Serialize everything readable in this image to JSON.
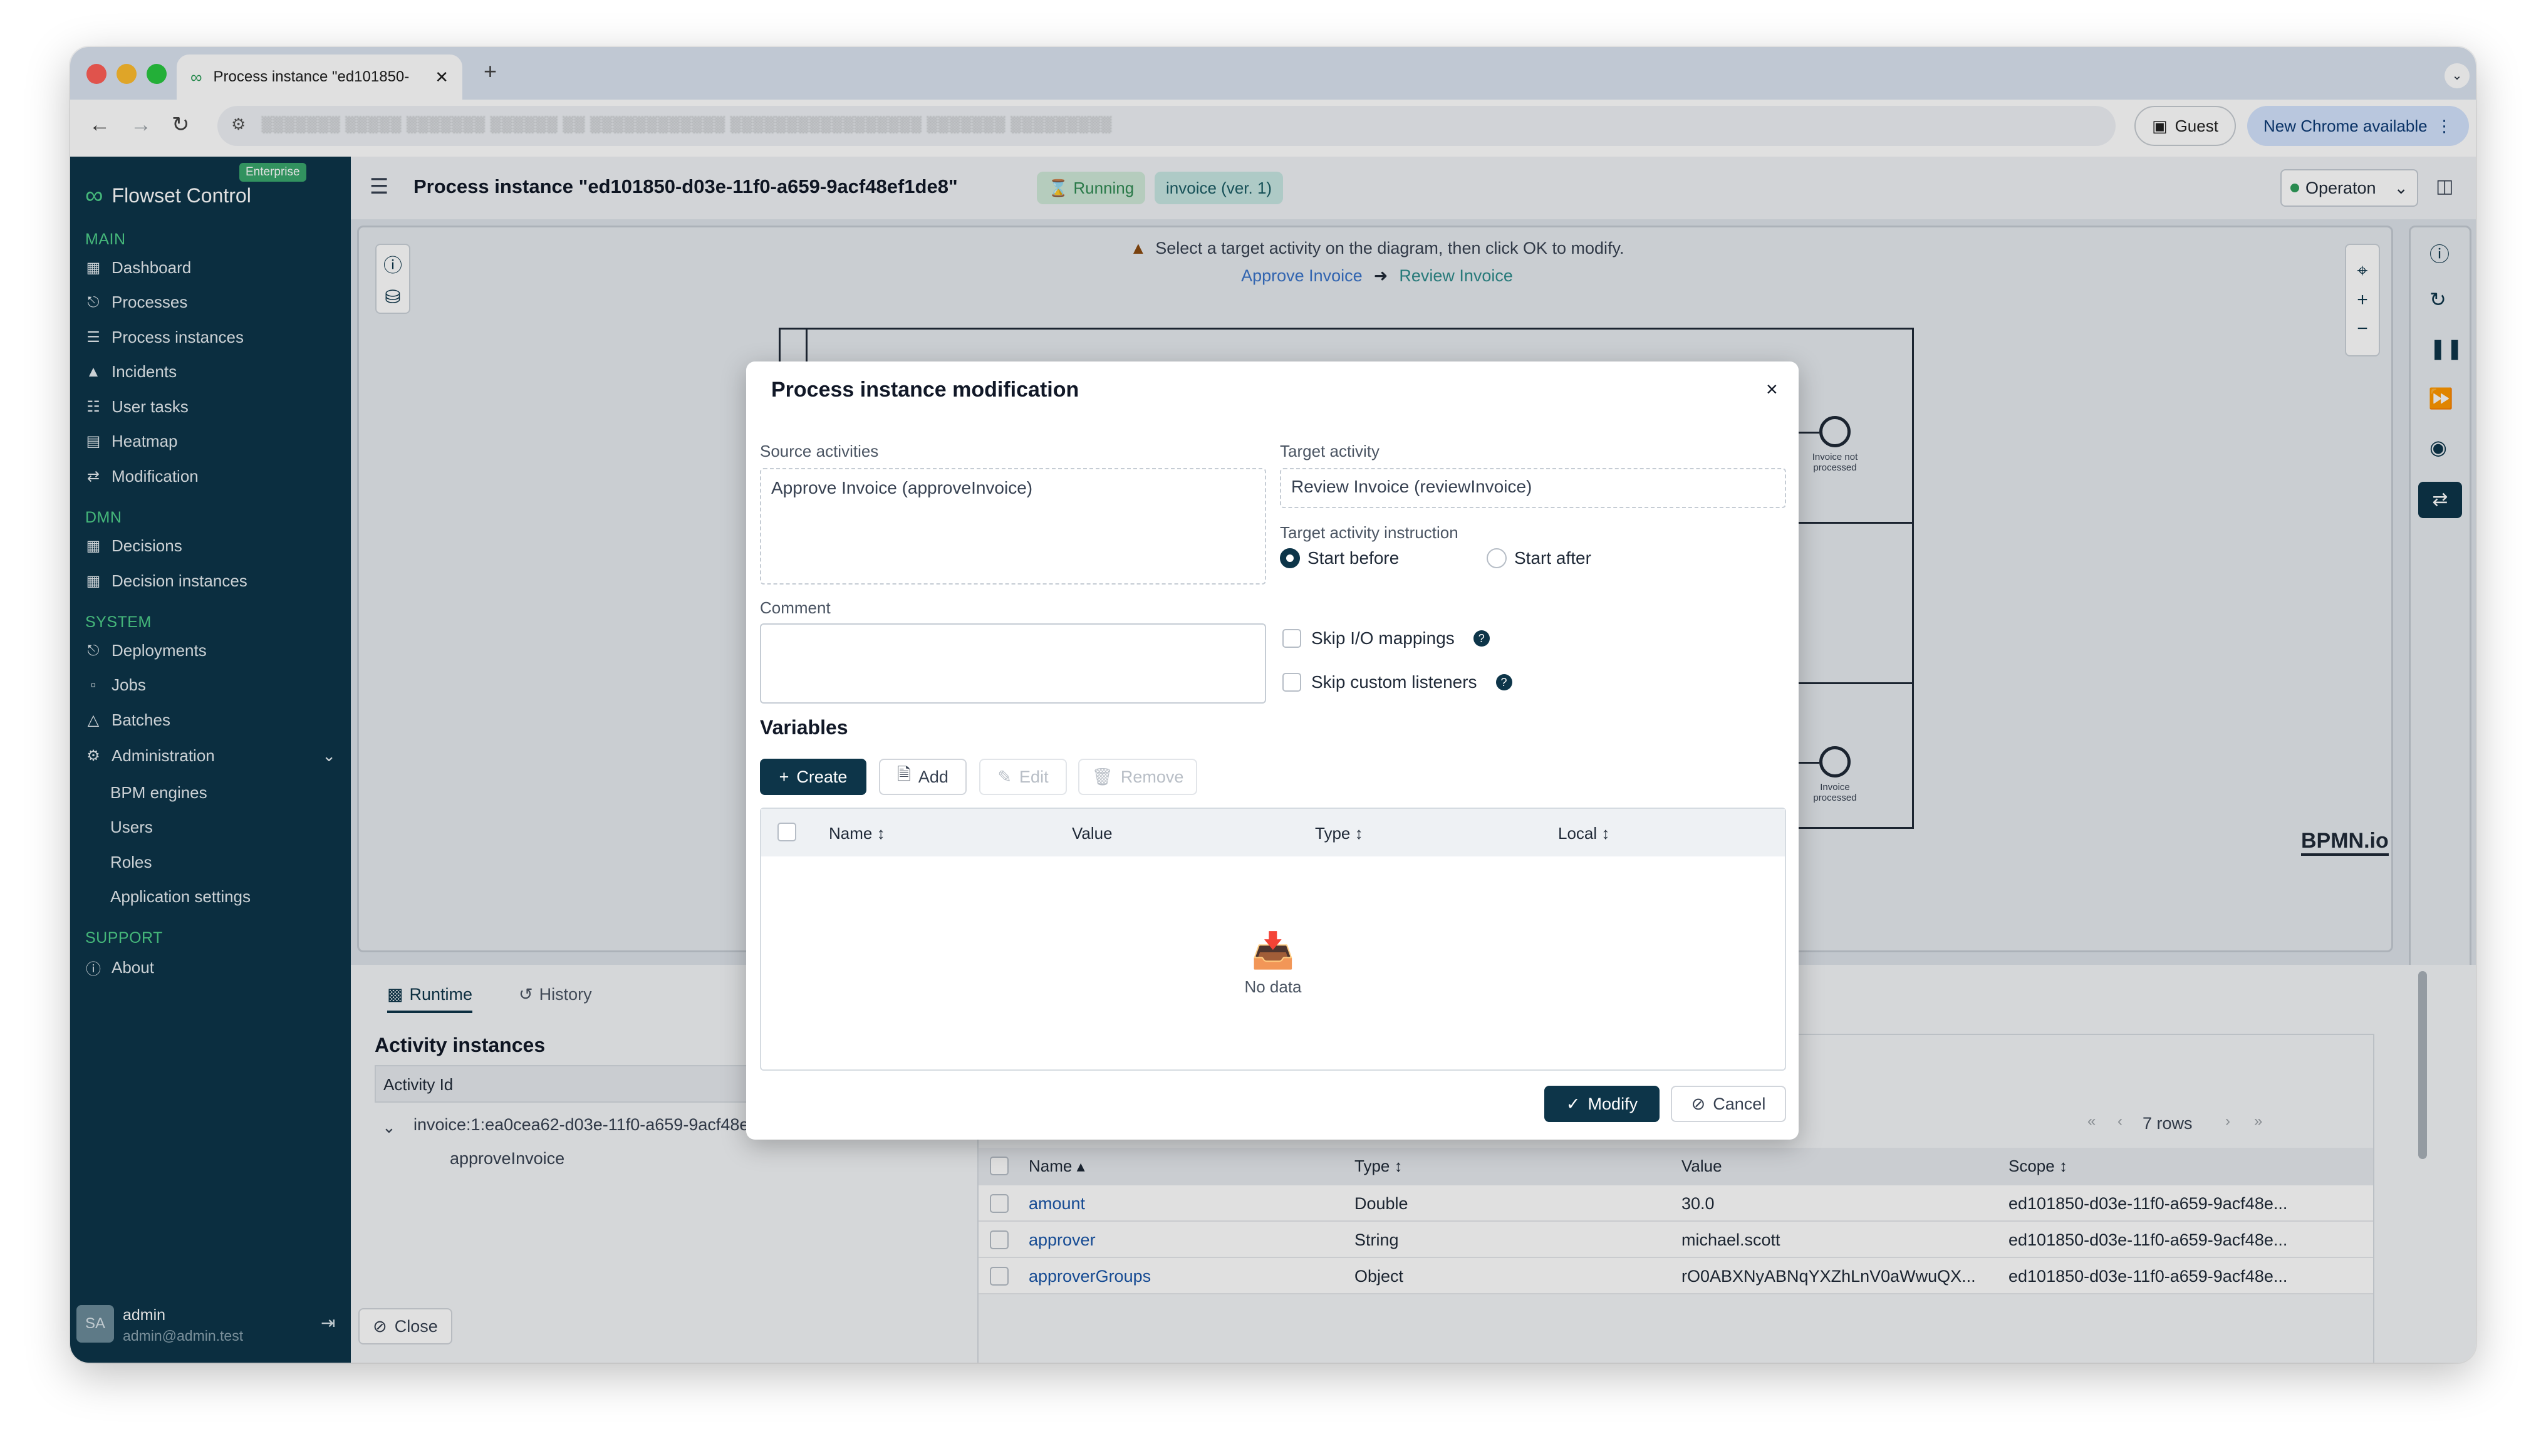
{
  "browser": {
    "tab_title": "Process instance \"ed101850-",
    "url": "░░░░░░░ ░░░░░ ░░░░░░░ ░░░░░░ ░░ ░░░░░░░░░░░░ ░░░░░░░░░░░░░░░░░ ░░░░░░░ ░░░░░░░░░",
    "guest_label": "Guest",
    "update_label": "New Chrome available"
  },
  "sidebar": {
    "brand": "Flowset Control",
    "edition": "Enterprise",
    "sections": {
      "main": "MAIN",
      "dmn": "DMN",
      "system": "SYSTEM",
      "support": "SUPPORT"
    },
    "items": {
      "dashboard": "Dashboard",
      "processes": "Processes",
      "process_instances": "Process instances",
      "incidents": "Incidents",
      "user_tasks": "User tasks",
      "heatmap": "Heatmap",
      "modification": "Modification",
      "decisions": "Decisions",
      "decision_instances": "Decision instances",
      "deployments": "Deployments",
      "jobs": "Jobs",
      "batches": "Batches",
      "administration": "Administration",
      "bpm_engines": "BPM engines",
      "users": "Users",
      "roles": "Roles",
      "application_settings": "Application settings",
      "about": "About"
    },
    "user": {
      "initials": "SA",
      "name": "admin",
      "email": "admin@admin.test"
    }
  },
  "header": {
    "title": "Process instance \"ed101850-d03e-11f0-a659-9acf48ef1de8\"",
    "status": "Running",
    "definition": "invoice (ver. 1)",
    "engine": "Operaton"
  },
  "diagram": {
    "hint": "Select a target activity on the diagram, then click OK to modify.",
    "from": "Approve Invoice",
    "to": "Review Invoice",
    "end_event_1": "Invoice not processed",
    "end_event_2": "Invoice processed",
    "bpmn_logo": "BPMN.io"
  },
  "modal": {
    "title": "Process instance modification",
    "source_label": "Source activities",
    "source_value": "Approve Invoice (approveInvoice)",
    "target_label": "Target activity",
    "target_value": "Review Invoice (reviewInvoice)",
    "instruction_label": "Target activity instruction",
    "start_before": "Start before",
    "start_after": "Start after",
    "comment_label": "Comment",
    "skip_io": "Skip I/O mappings",
    "skip_listeners": "Skip custom listeners",
    "variables_title": "Variables",
    "create": "Create",
    "add": "Add",
    "edit": "Edit",
    "remove": "Remove",
    "columns": {
      "name": "Name",
      "value": "Value",
      "type": "Type",
      "local": "Local"
    },
    "no_data": "No data",
    "modify": "Modify",
    "cancel": "Cancel"
  },
  "bottom": {
    "tabs": {
      "runtime": "Runtime",
      "history": "History"
    },
    "activity_instances_title": "Activity instances",
    "activity_id_header": "Activity Id",
    "tree_root": "invoice:1:ea0cea62-d03e-11f0-a659-9acf48ef1de8",
    "tree_child": "approveInvoice",
    "close": "Close",
    "rows_count": "7 rows",
    "var_columns": {
      "name": "Name",
      "type": "Type",
      "value": "Value",
      "scope": "Scope"
    },
    "rows": [
      {
        "name": "amount",
        "type": "Double",
        "value": "30.0",
        "scope": "ed101850-d03e-11f0-a659-9acf48e..."
      },
      {
        "name": "approver",
        "type": "String",
        "value": "michael.scott",
        "scope": "ed101850-d03e-11f0-a659-9acf48e..."
      },
      {
        "name": "approverGroups",
        "type": "Object",
        "value": "rO0ABXNyABNqYXZhLnV0aWwuQX...",
        "scope": "ed101850-d03e-11f0-a659-9acf48e..."
      }
    ]
  },
  "colors": {
    "sidebar": "#0d3549",
    "accent_green": "#4fd18b",
    "primary": "#0d3549"
  }
}
